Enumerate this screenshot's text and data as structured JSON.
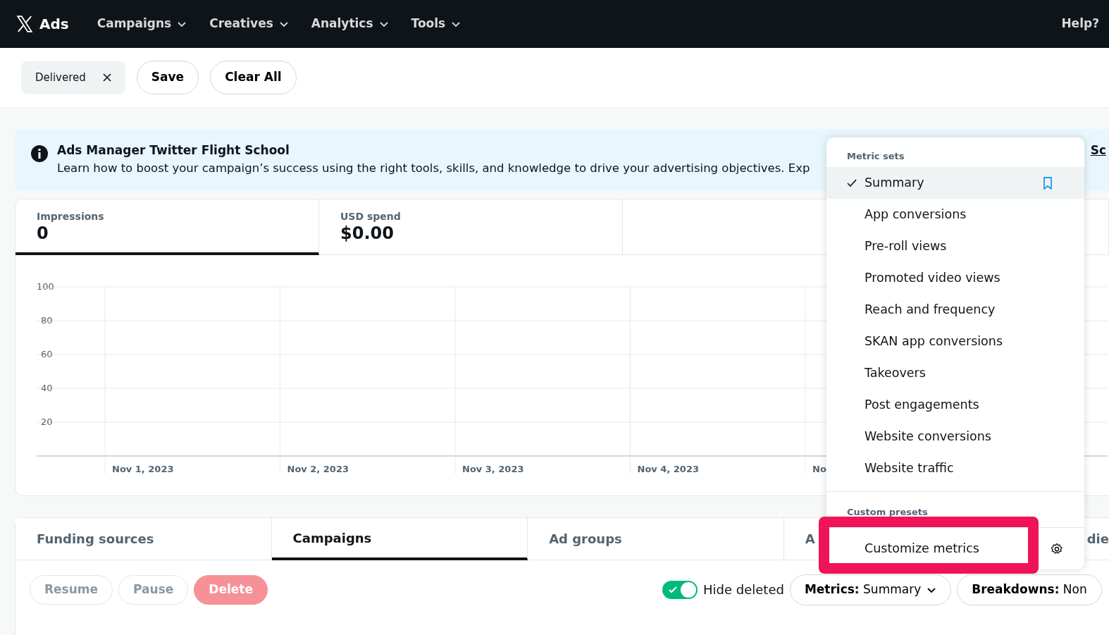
{
  "navbar": {
    "brand": "Ads",
    "menus": [
      {
        "label": "Campaigns"
      },
      {
        "label": "Creatives"
      },
      {
        "label": "Analytics"
      },
      {
        "label": "Tools"
      }
    ],
    "help": "Help?"
  },
  "filters": {
    "chips": [
      {
        "label": "Delivered"
      }
    ],
    "buttons": [
      "Save",
      "Clear All"
    ]
  },
  "banner": {
    "title": "Ads Manager Twitter Flight School",
    "text": "Learn how to boost your campaign’s success using the right tools, skills, and knowledge to drive your advertising objectives. Exp",
    "link": "Sc"
  },
  "stats": [
    {
      "label": "Impressions",
      "value": "0",
      "selected": true
    },
    {
      "label": "USD spend",
      "value": "$0.00",
      "selected": false
    }
  ],
  "chart_data": {
    "type": "line",
    "grid": true,
    "categories": [
      "Nov 1, 2023",
      "Nov 2, 2023",
      "Nov 3, 2023",
      "Nov 4, 2023",
      "No"
    ],
    "yticks": [
      20,
      40,
      60,
      80,
      100
    ],
    "ylim": [
      0,
      100
    ]
  },
  "tabs": [
    {
      "label": "Funding sources",
      "selected": false
    },
    {
      "label": "Campaigns",
      "selected": true
    },
    {
      "label": "Ad groups",
      "selected": false
    },
    {
      "label": "A",
      "selected": false
    },
    {
      "label": "die",
      "selected": false
    }
  ],
  "actions": [
    {
      "label": "Resume",
      "kind": "outline",
      "disabled": true
    },
    {
      "label": "Pause",
      "kind": "outline",
      "disabled": true
    },
    {
      "label": "Delete",
      "kind": "danger",
      "disabled": true
    }
  ],
  "hide_deleted": {
    "label": "Hide deleted",
    "on": true
  },
  "metrics_button": {
    "label": "Metrics:",
    "value": "Summary"
  },
  "breakdowns_button": {
    "label": "Breakdowns:",
    "value": "Non"
  },
  "menu": {
    "sections": [
      {
        "heading": "Metric sets",
        "items": [
          {
            "label": "Summary",
            "selected": true
          },
          {
            "label": "App conversions",
            "selected": false
          },
          {
            "label": "Pre-roll views",
            "selected": false
          },
          {
            "label": "Promoted video views",
            "selected": false
          },
          {
            "label": "Reach and frequency",
            "selected": false
          },
          {
            "label": "SKAN app conversions",
            "selected": false
          },
          {
            "label": "Takeovers",
            "selected": false
          },
          {
            "label": "Post engagements",
            "selected": false
          },
          {
            "label": "Website conversions",
            "selected": false
          },
          {
            "label": "Website traffic",
            "selected": false
          }
        ]
      },
      {
        "heading": "Custom presets"
      }
    ],
    "footer": {
      "label": "Customize metrics",
      "highlighted": true
    }
  }
}
